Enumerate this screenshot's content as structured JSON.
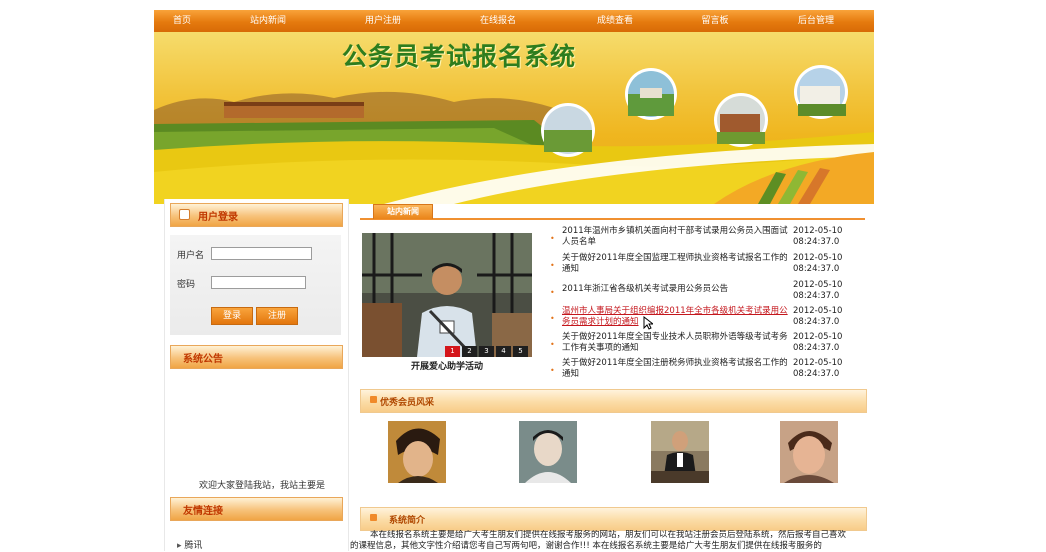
{
  "nav": {
    "items": [
      "首页",
      "站内新闻",
      "用户注册",
      "在线报名",
      "成绩查看",
      "留言板",
      "后台管理"
    ]
  },
  "banner": {
    "title": "公务员考试报名系统"
  },
  "login": {
    "header": "用户登录",
    "username_label": "用户名",
    "password_label": "密码",
    "login_button": "登录",
    "register_button": "注册"
  },
  "announcement": {
    "header": "系统公告",
    "text": "欢迎大家登陆我站，我站主要是"
  },
  "links": {
    "header": "友情连接",
    "items": [
      "腾讯"
    ]
  },
  "news": {
    "tab": "站内新闻",
    "slideshow": {
      "caption": "开展爱心助学活动",
      "pages": [
        "1",
        "2",
        "3",
        "4",
        "5"
      ],
      "active_page": "1"
    },
    "items": [
      {
        "title": "2011年温州市乡镇机关面向村干部考试录用公务员入围面试人员名单",
        "date": "2012-05-10",
        "time": "08:24:37.0"
      },
      {
        "title": "关于做好2011年度全国监理工程师执业资格考试报名工作的通知",
        "date": "2012-05-10",
        "time": "08:24:37.0"
      },
      {
        "title": "2011年浙江省各级机关考试录用公务员公告",
        "date": "2012-05-10",
        "time": "08:24:37.0"
      },
      {
        "title": "温州市人事局关于组织编报2011年全市各级机关考试录用公务员需求计划的通知",
        "date": "2012-05-10",
        "time": "08:24:37.0"
      },
      {
        "title": "关于做好2011年度全国专业技术人员职称外语等级考试考务工作有关事项的通知",
        "date": "2012-05-10",
        "time": "08:24:37.0"
      },
      {
        "title": "关于做好2011年度全国注册税务师执业资格考试报名工作的通知",
        "date": "2012-05-10",
        "time": "08:24:37.0"
      }
    ]
  },
  "members": {
    "header": "优秀会员风采"
  },
  "intro": {
    "header": "系统简介",
    "line1": "本在线报名系统主要是给广大考生朋友们提供在线报考服务的网站，朋友们可以在我站注册会员后登陆系统，然后报考自己喜欢",
    "line2": "的课程信息，其他文字性介绍请您考自己写两句吧，谢谢合作!!!     本在线报名系统主要是给广大考生朋友们提供在线报考服务的"
  },
  "colors": {
    "nav_orange": "#e57a0e",
    "header_text": "#c03800",
    "banner_title": "#2e7d1e",
    "link_red": "#c4161c"
  }
}
